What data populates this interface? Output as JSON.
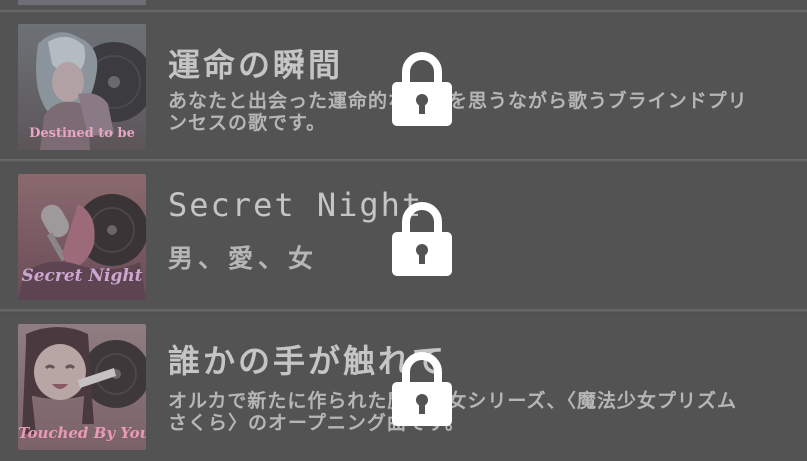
{
  "songs": [
    {
      "title": "運命の瞬間",
      "description": "あなたと出会った運命的な瞬間を思うながら歌うブラインドプリンセスの歌です。",
      "thumbnail_caption": "Destined to be",
      "locked": true
    },
    {
      "title": "Secret Night",
      "description": "男、愛、女",
      "thumbnail_caption": "Secret Night",
      "locked": true
    },
    {
      "title": "誰かの手が触れて",
      "description": "オルカで新たに作られた魔法少女シリーズ、〈魔法少女プリズムさくら〉のオープニング曲です。",
      "thumbnail_caption": "Touched By You",
      "locked": true
    }
  ],
  "icons": {
    "lock": "lock-icon",
    "album_disc": "vinyl-record-icon"
  },
  "colors": {
    "background": "#535353",
    "title_text": "#c5c5c5",
    "description_text": "#b6b6b6",
    "lock": "#ffffff",
    "thumb_caption_1": "#e7a6c3",
    "thumb_caption_2": "#c9a7cf",
    "thumb_caption_3": "#e99ab4"
  }
}
